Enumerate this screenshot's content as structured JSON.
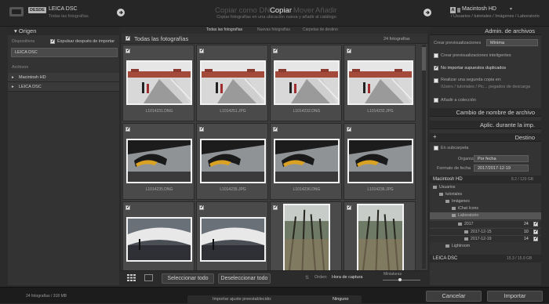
{
  "top": {
    "source_badge": "DESDE",
    "source_name": "LEICA DSC",
    "source_sub": "Todas las fotografías",
    "modes": [
      "Copiar como DNG",
      "Copiar",
      "Mover",
      "Añadir"
    ],
    "mode_sub": "Copiar fotografías en una ubicación nueva y añadir al catálogo",
    "dest_badge": "A",
    "dest_name": "Macintosh HD",
    "dest_path": "/ Usuarios / tutoriales / Imágenes / Laboratorio"
  },
  "left": {
    "title": "Origen",
    "devices_label": "Dispositivos",
    "eject_label": "Expulsar después de importar",
    "device": "LEICA DSC",
    "files_label": "Archivos",
    "files": [
      "Macintosh HD",
      "LEICA DSC"
    ]
  },
  "center": {
    "tabs": [
      "Todas las fotografías",
      "Nuevas fotografías",
      "Carpetas de destino"
    ],
    "header": "Todas las fotografías",
    "count": "24 fotografías",
    "files": [
      "L1014231.DNG",
      "L1014251.JPG",
      "L1014232.DNG",
      "L1014232.JPG",
      "L1014235.DNG",
      "L1014235.JPG",
      "L1014236.DNG",
      "L1014236.JPG",
      "",
      "",
      "",
      ""
    ],
    "select_all": "Seleccionar todo",
    "deselect_all": "Deseleccionar todo",
    "order_label": "Orden:",
    "order_value": "Hora de captura",
    "thumbs_label": "Miniaturas"
  },
  "right": {
    "file_handling": "Admin. de archivos",
    "previews_label": "Crear previsualizaciones",
    "previews_value": "Mínima",
    "smart_previews": "Crear previsualizaciones inteligentes",
    "no_duplicates": "No importar supuestos duplicados",
    "second_copy": "Realizar una segunda copia en:",
    "second_copy_path": "/Users / tutoriales / Pic... pegados de descarga",
    "add_collection": "Añadir a colección",
    "rename": "Cambio de nombre de archivo",
    "apply": "Aplic. durante la imp.",
    "destination": "Destino",
    "subfolder": "En subcarpeta",
    "organize_label": "Organizar",
    "organize_value": "Por fecha",
    "date_format_label": "Formato de fecha",
    "date_format_value": "2017/2017-12-19",
    "drive_name": "Macintosh HD",
    "drive_size": "8.2 / 120 GB",
    "tree": [
      {
        "label": "Usuarios",
        "count": ""
      },
      {
        "label": "tutoriales",
        "count": ""
      },
      {
        "label": "Imágenes",
        "count": ""
      },
      {
        "label": "iChat Icons",
        "count": ""
      },
      {
        "label": "Laboratorio",
        "count": ""
      },
      {
        "label": "2017",
        "count": "24"
      },
      {
        "label": "2017-12-15",
        "count": "10"
      },
      {
        "label": "2017-12-19",
        "count": "14"
      },
      {
        "label": "Lightroom",
        "count": ""
      }
    ],
    "card_name": "LEICA DSC",
    "card_size": "15.3 / 15.9 GB"
  },
  "bottom": {
    "status": "24 fotografías / 318 MB",
    "preset_label": "Importar ajuste preestablecido:",
    "preset_value": "Ninguno",
    "cancel": "Cancelar",
    "import": "Importar"
  },
  "colors": {
    "accent": "#e0e0e0",
    "panel": "#333333",
    "grid": "#3c3c3c"
  }
}
